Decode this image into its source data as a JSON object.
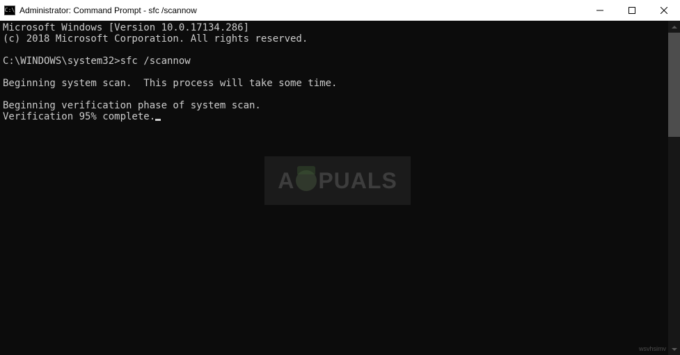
{
  "window": {
    "title": "Administrator: Command Prompt - sfc  /scannow"
  },
  "terminal": {
    "line1": "Microsoft Windows [Version 10.0.17134.286]",
    "line2": "(c) 2018 Microsoft Corporation. All rights reserved.",
    "blank1": "",
    "prompt_line": "C:\\WINDOWS\\system32>sfc /scannow",
    "blank2": "",
    "scan_line": "Beginning system scan.  This process will take some time.",
    "blank3": "",
    "verify_start": "Beginning verification phase of system scan.",
    "verify_progress": "Verification 95% complete."
  },
  "watermark": {
    "prefix": "A",
    "suffix": "PUALS"
  },
  "small_wm": "wsvhsimv"
}
